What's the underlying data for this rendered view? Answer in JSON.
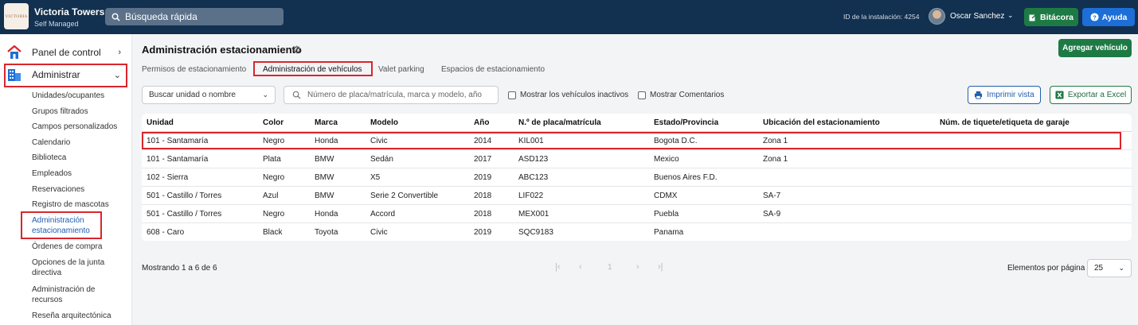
{
  "app": {
    "logo_text": "VICTORIA",
    "name": "Victoria Towers",
    "subtitle": "Self Managed"
  },
  "header": {
    "search_placeholder": "Búsqueda rápida",
    "installation_id": "ID de la instalación: 4254",
    "user_name": "Oscar Sanchez",
    "bitacora_label": "Bitácora",
    "ayuda_label": "Ayuda"
  },
  "sidebar": {
    "panel_label": "Panel de control",
    "admin_label": "Administrar",
    "items": [
      "Unidades/ocupantes",
      "Grupos filtrados",
      "Campos personalizados",
      "Calendario",
      "Biblioteca",
      "Empleados",
      "Reservaciones",
      "Registro de mascotas",
      "Administración estacionamiento",
      "Órdenes de compra",
      "Opciones de la junta directiva",
      "Administración de recursos",
      "Reseña arquitectónica"
    ]
  },
  "page": {
    "title": "Administración estacionamiento",
    "add_button": "Agregar vehículo",
    "tabs": [
      "Permisos de estacionamiento",
      "Administración de vehículos",
      "Valet parking",
      "Espacios de estacionamiento"
    ],
    "active_tab": "Administración de vehículos"
  },
  "filters": {
    "unit_select": "Buscar unidad o nombre",
    "plate_placeholder": "Número de placa/matrícula, marca y modelo, año",
    "show_inactive": "Mostrar los vehículos inactivos",
    "show_comments": "Mostrar Comentarios",
    "print_label": "Imprimir vista",
    "excel_label": "Exportar a Excel"
  },
  "table": {
    "headers": [
      "Unidad",
      "Color",
      "Marca",
      "Modelo",
      "Año",
      "N.º de placa/matrícula",
      "Estado/Provincia",
      "Ubicación del estacionamiento",
      "Núm. de tiquete/etiqueta de garaje"
    ],
    "rows": [
      [
        "101 - Santamaría",
        "Negro",
        "Honda",
        "Civic",
        "2014",
        "KIL001",
        "Bogota D.C.",
        "Zona 1",
        ""
      ],
      [
        "101 - Santamaría",
        "Plata",
        "BMW",
        "Sedán",
        "2017",
        "ASD123",
        "Mexico",
        "Zona 1",
        ""
      ],
      [
        "102 - Sierra",
        "Negro",
        "BMW",
        "X5",
        "2019",
        "ABC123",
        "Buenos Aires F.D.",
        "",
        ""
      ],
      [
        "501 - Castillo / Torres",
        "Azul",
        "BMW",
        "Serie 2 Convertible",
        "2018",
        "LIF022",
        "CDMX",
        "SA-7",
        ""
      ],
      [
        "501 - Castillo / Torres",
        "Negro",
        "Honda",
        "Accord",
        "2018",
        "MEX001",
        "Puebla",
        "SA-9",
        ""
      ],
      [
        "608 - Caro",
        "Black",
        "Toyota",
        "Civic",
        "2019",
        "SQC9183",
        "Panama",
        "",
        ""
      ]
    ]
  },
  "footer": {
    "showing": "Mostrando 1 a 6 de 6",
    "page_number": "1",
    "per_page_label": "Elementos por página",
    "per_page_value": "25"
  },
  "colors": {
    "topbar": "#12304f",
    "green": "#1e7a45",
    "blue": "#1d6ed6",
    "highlight": "#d9262c"
  }
}
